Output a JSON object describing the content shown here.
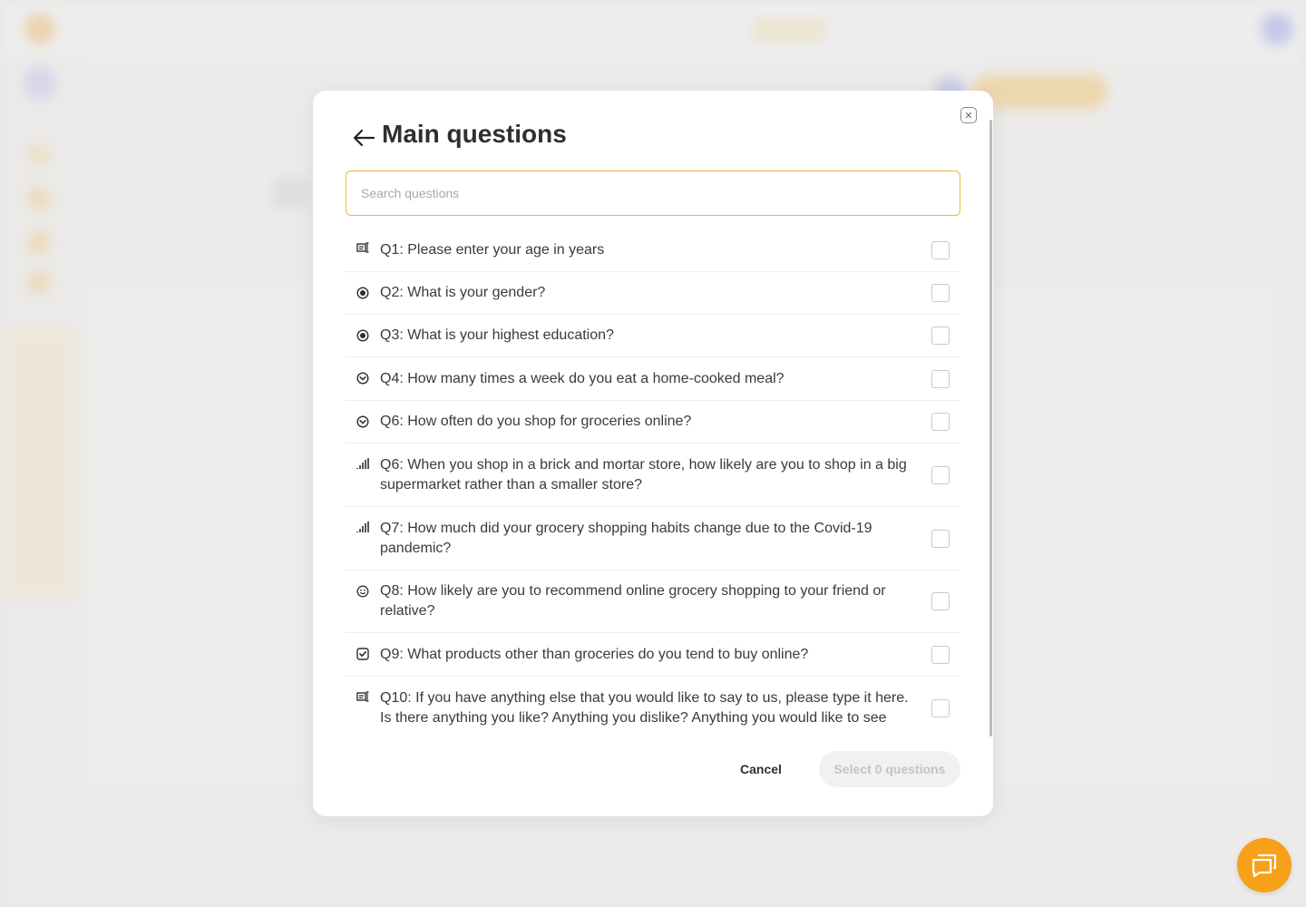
{
  "modal": {
    "title": "Main questions",
    "search_placeholder": "Search questions",
    "questions": [
      {
        "label": "Q1: Please enter your age in years",
        "icon": "number-input-icon"
      },
      {
        "label": "Q2: What is your gender?",
        "icon": "radio-icon"
      },
      {
        "label": "Q3: What is your highest education?",
        "icon": "radio-icon"
      },
      {
        "label": "Q4: How many times a week do you eat a home-cooked meal?",
        "icon": "dropdown-icon"
      },
      {
        "label": "Q6: How often do you shop for groceries online?",
        "icon": "dropdown-icon"
      },
      {
        "label": "Q6: When you shop in a brick and mortar store, how likely are you to shop in a big supermarket rather than a smaller store?",
        "icon": "scale-icon"
      },
      {
        "label": "Q7: How much did your grocery shopping habits change due to the Covid-19 pandemic?",
        "icon": "scale-icon"
      },
      {
        "label": "Q8: How likely are you to recommend online grocery shopping to your friend or relative?",
        "icon": "smiley-icon"
      },
      {
        "label": "Q9: What products other than groceries do you tend to buy online?",
        "icon": "checkbox-icon"
      },
      {
        "label": "Q10: If you have anything else that you would like to say to us, please type it here. Is there anything you like? Anything you dislike? Anything you would like to see",
        "icon": "text-input-icon"
      }
    ],
    "cancel_label": "Cancel",
    "select_label": "Select 0 questions"
  },
  "colors": {
    "accent": "#f0b63c",
    "fab": "#f7a11a"
  }
}
